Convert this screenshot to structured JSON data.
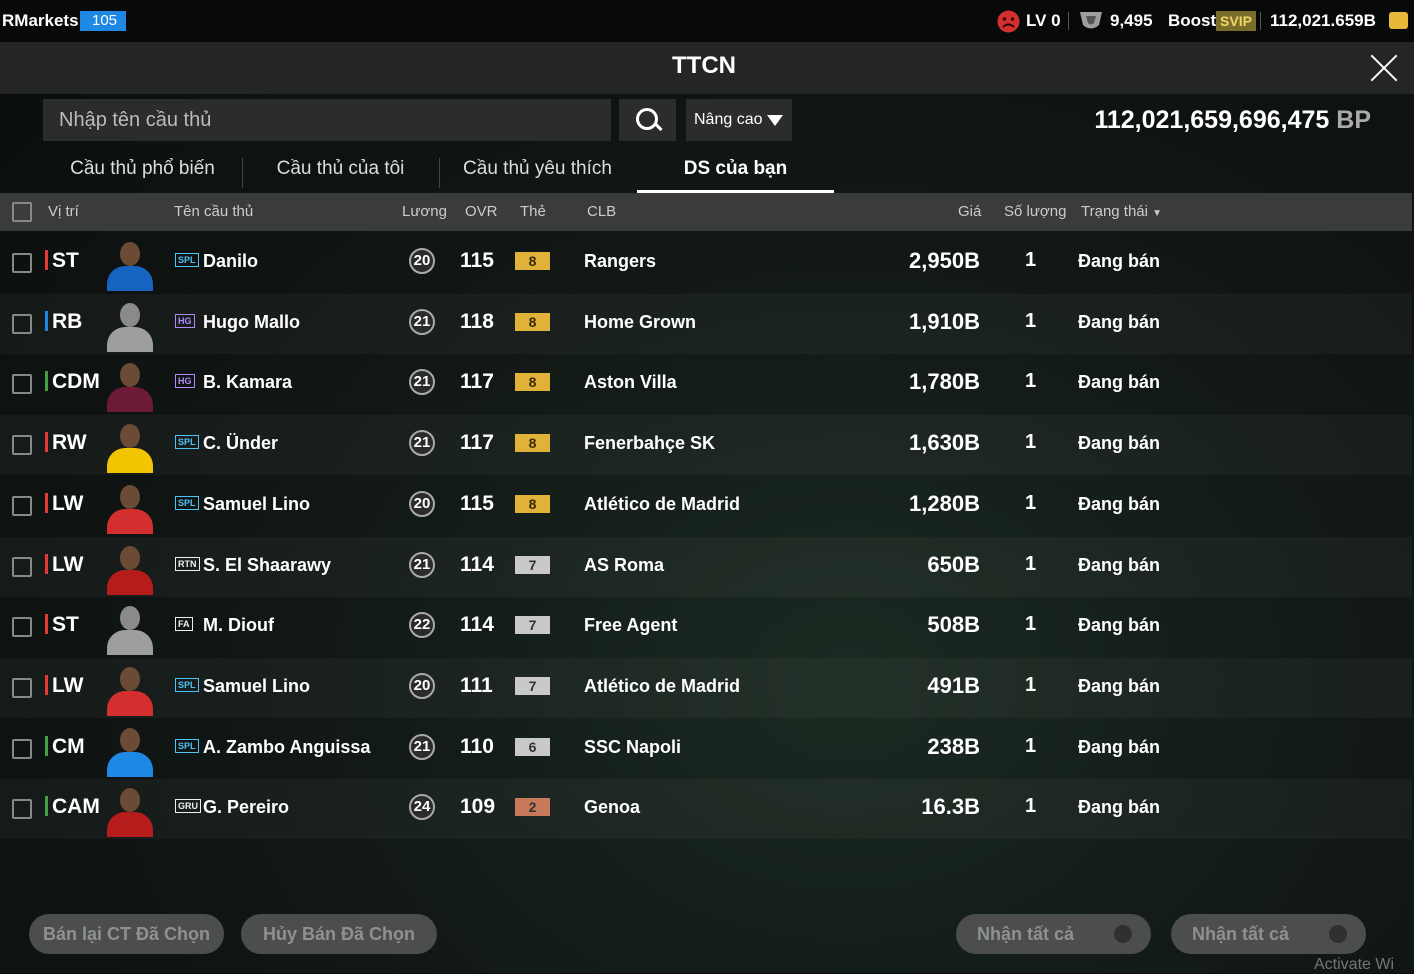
{
  "topbar": {
    "app_name": "RMarkets",
    "badge": "105",
    "level": "LV 0",
    "trophies": "9,495",
    "boost_label": "Boost",
    "svip": "SVIP",
    "coins": "112,021.659B"
  },
  "header": {
    "title": "TTCN"
  },
  "search": {
    "placeholder": "Nhập tên cầu thủ",
    "advanced_label": "Nâng cao",
    "balance": "112,021,659,696,475",
    "balance_unit": "BP"
  },
  "tabs": [
    {
      "label": "Cầu thủ phổ biến",
      "active": false
    },
    {
      "label": "Cầu thủ của tôi",
      "active": false
    },
    {
      "label": "Cầu thủ yêu thích",
      "active": false
    },
    {
      "label": "DS của bạn",
      "active": true
    }
  ],
  "table": {
    "headers": {
      "position": "Vị trí",
      "name": "Tên cầu thủ",
      "salary": "Lương",
      "ovr": "OVR",
      "card": "Thẻ",
      "club": "CLB",
      "price": "Giá",
      "quantity": "Số lượng",
      "status": "Trạng thái"
    },
    "rows": [
      {
        "position": "ST",
        "pos_color": "#e53935",
        "league": "SPL",
        "name": "Danilo",
        "salary": "20",
        "ovr": "115",
        "card": "8",
        "club": "Rangers",
        "price": "2,950B",
        "quantity": "1",
        "status": "Đang bán"
      },
      {
        "position": "RB",
        "pos_color": "#1e88e5",
        "league": "HG",
        "name": "Hugo Mallo",
        "salary": "21",
        "ovr": "118",
        "card": "8",
        "club": "Home Grown",
        "price": "1,910B",
        "quantity": "1",
        "status": "Đang bán"
      },
      {
        "position": "CDM",
        "pos_color": "#43a047",
        "league": "HG",
        "name": "B. Kamara",
        "salary": "21",
        "ovr": "117",
        "card": "8",
        "club": "Aston Villa",
        "price": "1,780B",
        "quantity": "1",
        "status": "Đang bán"
      },
      {
        "position": "RW",
        "pos_color": "#e53935",
        "league": "SPL",
        "name": "C. Ünder",
        "salary": "21",
        "ovr": "117",
        "card": "8",
        "club": "Fenerbahçe SK",
        "price": "1,630B",
        "quantity": "1",
        "status": "Đang bán"
      },
      {
        "position": "LW",
        "pos_color": "#e53935",
        "league": "SPL",
        "name": "Samuel Lino",
        "salary": "20",
        "ovr": "115",
        "card": "8",
        "club": "Atlético de Madrid",
        "price": "1,280B",
        "quantity": "1",
        "status": "Đang bán"
      },
      {
        "position": "LW",
        "pos_color": "#e53935",
        "league": "RTN",
        "name": "S. El Shaarawy",
        "salary": "21",
        "ovr": "114",
        "card": "7",
        "club": "AS Roma",
        "price": "650B",
        "quantity": "1",
        "status": "Đang bán"
      },
      {
        "position": "ST",
        "pos_color": "#e53935",
        "league": "FA",
        "name": "M. Diouf",
        "salary": "22",
        "ovr": "114",
        "card": "7",
        "club": "Free Agent",
        "price": "508B",
        "quantity": "1",
        "status": "Đang bán"
      },
      {
        "position": "LW",
        "pos_color": "#e53935",
        "league": "SPL",
        "name": "Samuel Lino",
        "salary": "20",
        "ovr": "111",
        "card": "7",
        "club": "Atlético de Madrid",
        "price": "491B",
        "quantity": "1",
        "status": "Đang bán"
      },
      {
        "position": "CM",
        "pos_color": "#43a047",
        "league": "SPL",
        "name": "A. Zambo Anguissa",
        "salary": "21",
        "ovr": "110",
        "card": "6",
        "club": "SSC Napoli",
        "price": "238B",
        "quantity": "1",
        "status": "Đang bán"
      },
      {
        "position": "CAM",
        "pos_color": "#43a047",
        "league": "GRU",
        "name": "G. Pereiro",
        "salary": "24",
        "ovr": "109",
        "card": "2",
        "club": "Genoa",
        "price": "16.3B",
        "quantity": "1",
        "status": "Đang bán"
      }
    ]
  },
  "footer": {
    "resell_label": "Bán lại CT Đã Chọn",
    "cancel_label": "Hủy Bán Đã Chọn",
    "claim_all_label_1": "Nhận tất cả",
    "claim_all_label_2": "Nhận tất cả"
  },
  "watermark": "Activate Wi",
  "colors": {
    "card_gold": "#e0b23a",
    "card_silver": "#c9c9c9",
    "card_bronze": "#c77a5a",
    "league_spl": "#4fc3f7",
    "league_hg": "#b388ff",
    "league_other": "#f0f0f0"
  }
}
